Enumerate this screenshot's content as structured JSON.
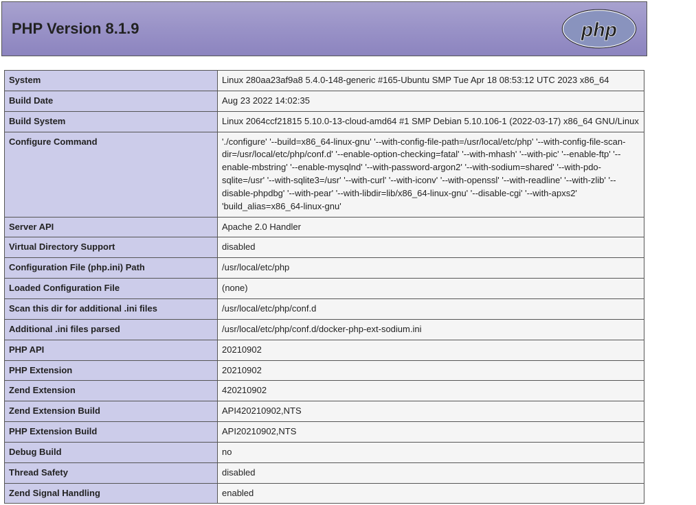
{
  "header": {
    "title": "PHP Version 8.1.9"
  },
  "rows": [
    {
      "label": "System",
      "value": "Linux 280aa23af9a8 5.4.0-148-generic #165-Ubuntu SMP Tue Apr 18 08:53:12 UTC 2023 x86_64"
    },
    {
      "label": "Build Date",
      "value": "Aug 23 2022 14:02:35"
    },
    {
      "label": "Build System",
      "value": "Linux 2064ccf21815 5.10.0-13-cloud-amd64 #1 SMP Debian 5.10.106-1 (2022-03-17) x86_64 GNU/Linux"
    },
    {
      "label": "Configure Command",
      "value": "'./configure' '--build=x86_64-linux-gnu' '--with-config-file-path=/usr/local/etc/php' '--with-config-file-scan-dir=/usr/local/etc/php/conf.d' '--enable-option-checking=fatal' '--with-mhash' '--with-pic' '--enable-ftp' '--enable-mbstring' '--enable-mysqlnd' '--with-password-argon2' '--with-sodium=shared' '--with-pdo-sqlite=/usr' '--with-sqlite3=/usr' '--with-curl' '--with-iconv' '--with-openssl' '--with-readline' '--with-zlib' '--disable-phpdbg' '--with-pear' '--with-libdir=lib/x86_64-linux-gnu' '--disable-cgi' '--with-apxs2' 'build_alias=x86_64-linux-gnu'"
    },
    {
      "label": "Server API",
      "value": "Apache 2.0 Handler"
    },
    {
      "label": "Virtual Directory Support",
      "value": "disabled"
    },
    {
      "label": "Configuration File (php.ini) Path",
      "value": "/usr/local/etc/php"
    },
    {
      "label": "Loaded Configuration File",
      "value": "(none)"
    },
    {
      "label": "Scan this dir for additional .ini files",
      "value": "/usr/local/etc/php/conf.d"
    },
    {
      "label": "Additional .ini files parsed",
      "value": "/usr/local/etc/php/conf.d/docker-php-ext-sodium.ini"
    },
    {
      "label": "PHP API",
      "value": "20210902"
    },
    {
      "label": "PHP Extension",
      "value": "20210902"
    },
    {
      "label": "Zend Extension",
      "value": "420210902"
    },
    {
      "label": "Zend Extension Build",
      "value": "API420210902,NTS"
    },
    {
      "label": "PHP Extension Build",
      "value": "API20210902,NTS"
    },
    {
      "label": "Debug Build",
      "value": "no"
    },
    {
      "label": "Thread Safety",
      "value": "disabled"
    },
    {
      "label": "Zend Signal Handling",
      "value": "enabled"
    }
  ]
}
